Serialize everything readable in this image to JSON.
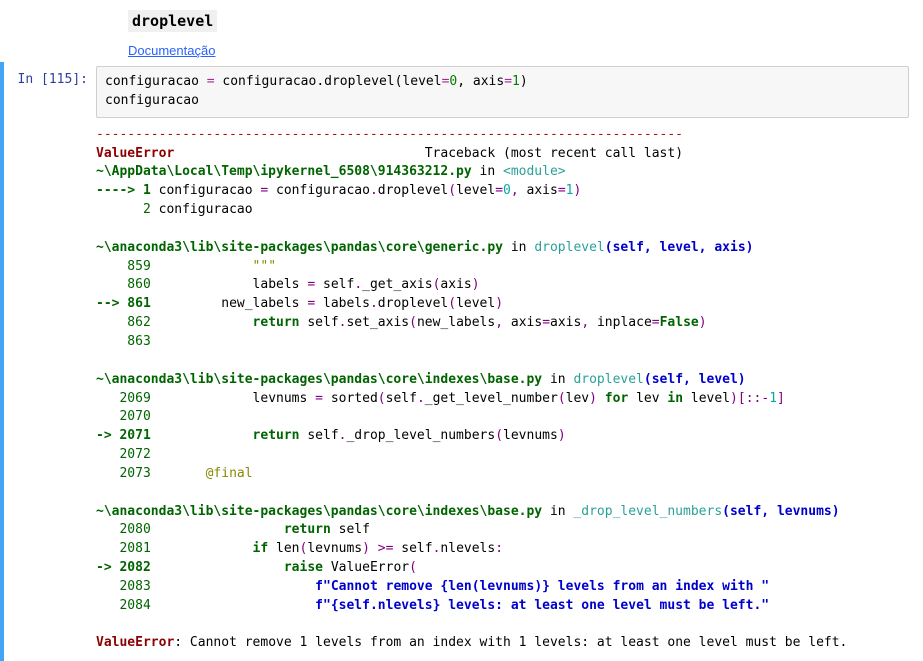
{
  "markdown": {
    "title": "droplevel",
    "doc_link": "Documentação"
  },
  "code_cell": {
    "prompt": "In [115]:",
    "code_line1_prefix": "configuracao ",
    "code_line1_eq": "=",
    "code_line1_mid": " configuracao.droplevel(level",
    "code_line1_eq2": "=",
    "code_line1_zero": "0",
    "code_line1_comma": ", axis",
    "code_line1_eq3": "=",
    "code_line1_one": "1",
    "code_line1_close": ")",
    "code_line2": "configuracao"
  },
  "traceback": {
    "dashes": "---------------------------------------------------------------------------",
    "err_name": "ValueError",
    "tb_header": "                                Traceback (most recent call last)",
    "frame1_path": "~\\AppData\\Local\\Temp\\ipykernel_6508\\914363212.py",
    "in_word": " in ",
    "module": "<module>",
    "arrow4": "----> 1",
    "f1_l1_a": " configuracao ",
    "f1_l1_op": "=",
    "f1_l1_b": " configuracao",
    "f1_l1_dot": ".",
    "f1_l1_c": "droplevel",
    "f1_l1_paren": "(",
    "f1_l1_d": "level",
    "f1_l1_eq": "=",
    "f1_l1_zero": "0",
    "f1_l1_comma": ",",
    "f1_l1_e": " axis",
    "f1_l1_eq2": "=",
    "f1_l1_one": "1",
    "f1_l1_close": ")",
    "f1_indent2": "      2",
    "f1_l2": " configuracao",
    "frame2_path": "~\\anaconda3\\lib\\site-packages\\pandas\\core\\generic.py",
    "frame2_func": "droplevel",
    "frame2_sig_open": "(self, level, axis)",
    "ln859": "    859",
    "ln859_txt": "             \"\"\"",
    "ln860": "    860",
    "ln860_a": "             labels ",
    "ln860_b": "=",
    "ln860_c": " self",
    "ln860_d": ".",
    "ln860_e": "_get_axis",
    "ln860_f": "(",
    "ln860_g": "axis",
    "ln860_h": ")",
    "arrow861": "--> 861",
    "ln861_a": "         new_labels ",
    "ln861_b": "=",
    "ln861_c": " labels",
    "ln861_d": ".",
    "ln861_e": "droplevel",
    "ln861_f": "(",
    "ln861_g": "level",
    "ln861_h": ")",
    "ln862": "    862",
    "ln862_a": "             ",
    "ln862_ret": "return",
    "ln862_b": " self",
    "ln862_c": ".",
    "ln862_d": "set_axis",
    "ln862_e": "(",
    "ln862_f": "new_labels",
    "ln862_g": ",",
    "ln862_h": " axis",
    "ln862_i": "=",
    "ln862_j": "axis",
    "ln862_k": ",",
    "ln862_l": " inplace",
    "ln862_m": "=",
    "ln862_false": "False",
    "ln862_n": ")",
    "ln863": "    863",
    "frame3_path": "~\\anaconda3\\lib\\site-packages\\pandas\\core\\indexes\\base.py",
    "frame3_func": "droplevel",
    "frame3_sig": "(self, level)",
    "ln2069": "   2069",
    "ln2069_a": "             levnums ",
    "ln2069_b": "=",
    "ln2069_c": " sorted",
    "ln2069_d": "(",
    "ln2069_e": "self",
    "ln2069_f": ".",
    "ln2069_g": "_get_level_number",
    "ln2069_h": "(",
    "ln2069_i": "lev",
    "ln2069_j": ")",
    "ln2069_k": " ",
    "ln2069_for": "for",
    "ln2069_l": " lev ",
    "ln2069_in": "in",
    "ln2069_m": " level",
    "ln2069_n": ")[::",
    "ln2069_neg1": "-",
    "ln2069_one": "1",
    "ln2069_o": "]",
    "ln2070": "   2070",
    "arrow2071": "-> 2071",
    "ln2071_a": "             ",
    "ln2071_ret": "return",
    "ln2071_b": " self",
    "ln2071_c": ".",
    "ln2071_d": "_drop_level_numbers",
    "ln2071_e": "(",
    "ln2071_f": "levnums",
    "ln2071_g": ")",
    "ln2072": "   2072",
    "ln2073": "   2073",
    "ln2073_a": "       ",
    "ln2073_at": "@final",
    "frame4_path": "~\\anaconda3\\lib\\site-packages\\pandas\\core\\indexes\\base.py",
    "frame4_func": "_drop_level_numbers",
    "frame4_sig": "(self, levnums)",
    "ln2080": "   2080",
    "ln2080_a": "                 ",
    "ln2080_ret": "return",
    "ln2080_b": " self",
    "ln2081": "   2081",
    "ln2081_a": "             ",
    "ln2081_if": "if",
    "ln2081_b": " len",
    "ln2081_c": "(",
    "ln2081_d": "levnums",
    "ln2081_e": ")",
    "ln2081_f": " ",
    "ln2081_ge": ">",
    "ln2081_eq": "=",
    "ln2081_g": " self",
    "ln2081_h": ".",
    "ln2081_i": "nlevels",
    "ln2081_j": ":",
    "arrow2082": "-> 2082",
    "ln2082_a": "                 ",
    "ln2082_raise": "raise",
    "ln2082_b": " ValueError",
    "ln2082_c": "(",
    "ln2083": "   2083",
    "ln2083_a": "                     ",
    "ln2083_str": "f\"Cannot remove {len(levnums)} levels from an index with \"",
    "ln2084": "   2084",
    "ln2084_a": "                     ",
    "ln2084_str": "f\"{self.nlevels} levels: at least one level must be left.\"",
    "final_err": "ValueError",
    "final_msg": ": Cannot remove 1 levels from an index with 1 levels: at least one level must be left."
  }
}
